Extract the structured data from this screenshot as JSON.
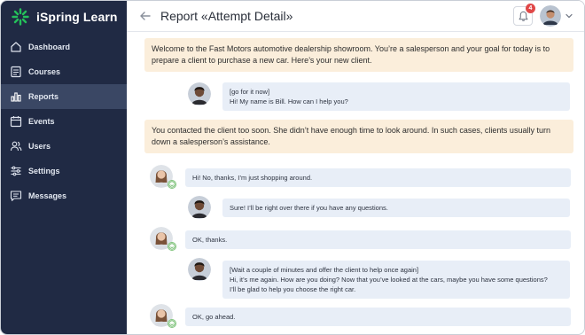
{
  "app": {
    "name": "iSpring Learn",
    "brand_color": "#24c05a"
  },
  "sidebar": {
    "items": [
      {
        "label": "Dashboard",
        "icon": "home-icon",
        "active": false
      },
      {
        "label": "Courses",
        "icon": "courses-icon",
        "active": false
      },
      {
        "label": "Reports",
        "icon": "reports-icon",
        "active": true
      },
      {
        "label": "Events",
        "icon": "calendar-icon",
        "active": false
      },
      {
        "label": "Users",
        "icon": "users-icon",
        "active": false
      },
      {
        "label": "Settings",
        "icon": "settings-icon",
        "active": false
      },
      {
        "label": "Messages",
        "icon": "messages-icon",
        "active": false
      }
    ]
  },
  "header": {
    "title": "Report «Attempt Detail»",
    "notifications_count": "4"
  },
  "conversation": {
    "intro": "Welcome to the Fast Motors automotive dealership showroom. You’re a salesperson and your goal for today is to prepare a client to purchase a new car. Here’s your new client.",
    "sales_1": {
      "action": "[go for it now]",
      "text": "Hi! My name is Bill. How can I help you?"
    },
    "feedback": "You contacted the client too soon. She didn’t have enough time to look around. In such cases, clients usually turn down a salesperson’s assistance.",
    "client_1": "Hi! No, thanks, I’m just shopping around.",
    "sales_2": "Sure! I’ll be right over there if you have any questions.",
    "client_2": "OK, thanks.",
    "sales_3": {
      "action": "[Wait a couple of minutes and offer the client to help once again]",
      "line1": "Hi, it’s me again. How are you doing? Now that you’ve looked at the cars, maybe you have some questions?",
      "line2": "I’ll be glad to help you choose the right car."
    },
    "client_3": "OK, go ahead."
  }
}
